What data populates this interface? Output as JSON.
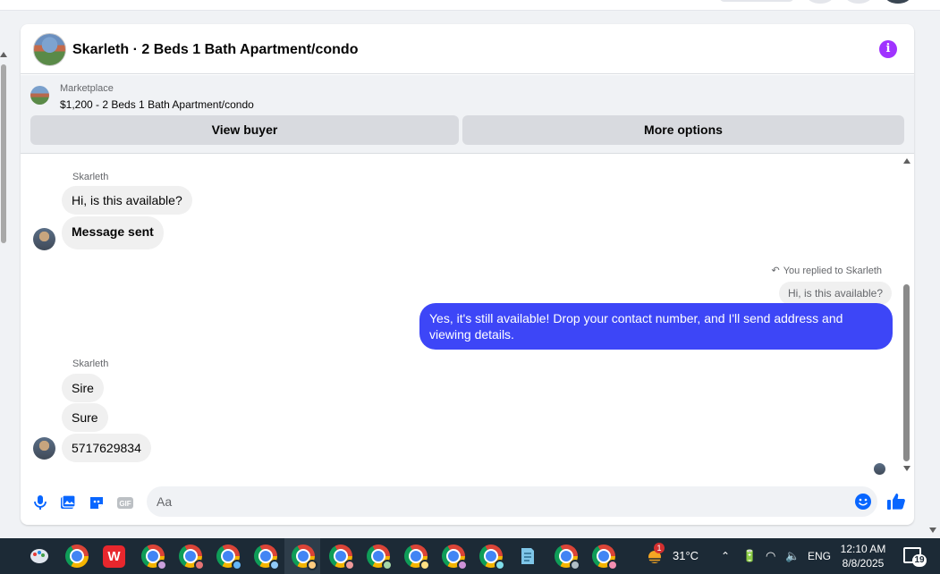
{
  "conversation": {
    "title": "Skarleth · 2 Beds 1 Bath Apartment/condo",
    "info_icon": "info-icon"
  },
  "marketplace": {
    "label": "Marketplace",
    "listing": "$1,200 - 2 Beds 1 Bath Apartment/condo",
    "view_buyer": "View buyer",
    "more_options": "More options"
  },
  "messages": {
    "group1": {
      "sender": "Skarleth",
      "items": [
        "Hi, is this available?",
        "Message sent"
      ]
    },
    "reply": {
      "note": "You replied to Skarleth",
      "quoted": "Hi, is this available?",
      "text": "Yes, it's still available! Drop your contact number, and I'll send address and viewing details."
    },
    "group2": {
      "sender": "Skarleth",
      "items": [
        "Sire",
        "Sure",
        "5717629834"
      ]
    }
  },
  "composer": {
    "placeholder": "Aa"
  },
  "taskbar": {
    "temperature": "31°C",
    "language": "ENG",
    "time": "12:10 AM",
    "date": "8/8/2025",
    "weather_badge": "1",
    "notifications": "19"
  },
  "colors": {
    "outgoing_bubble": "#3d46f7",
    "accent": "#0866ff",
    "info": "#a033ff"
  }
}
